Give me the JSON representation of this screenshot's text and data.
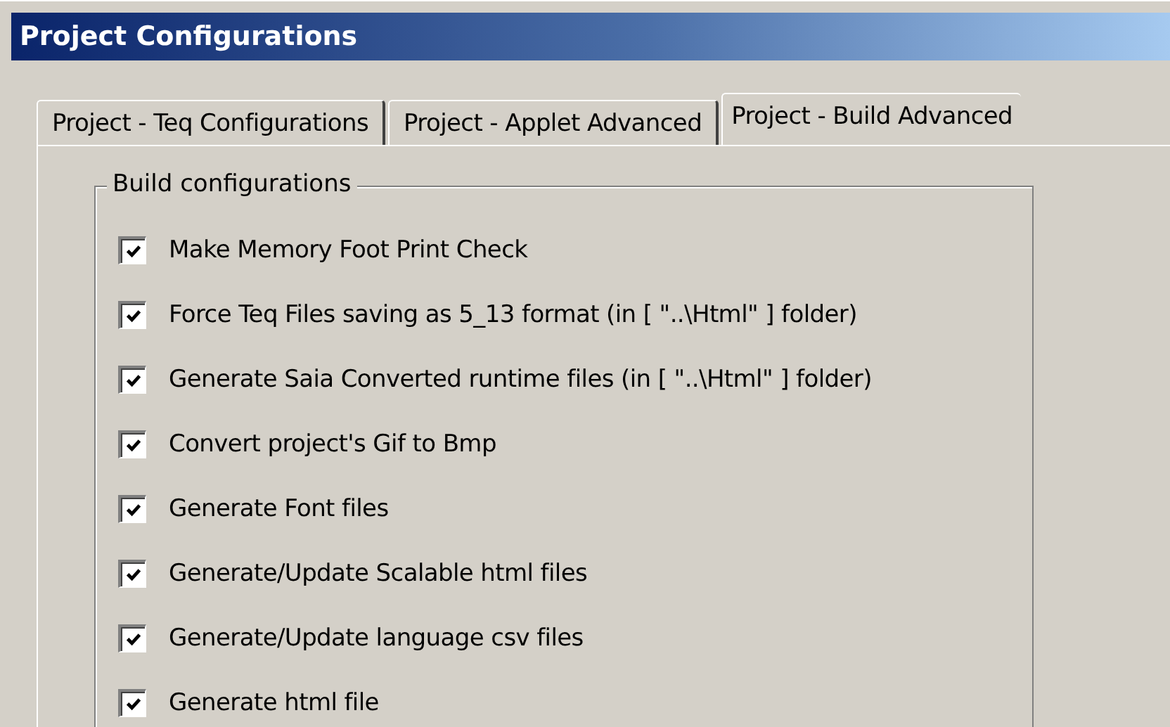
{
  "window": {
    "title": "Project Configurations"
  },
  "tabs": [
    {
      "label": "Project - Teq Configurations",
      "selected": false
    },
    {
      "label": "Project - Applet Advanced",
      "selected": false
    },
    {
      "label": "Project - Build Advanced",
      "selected": true
    }
  ],
  "group": {
    "title": "Build configurations",
    "options": [
      {
        "label": "Make Memory Foot Print Check",
        "checked": true
      },
      {
        "label": "Force Teq Files saving as 5_13 format (in [ \"..\\Html\" ] folder)",
        "checked": true
      },
      {
        "label": "Generate Saia Converted runtime files (in [ \"..\\Html\" ] folder)",
        "checked": true
      },
      {
        "label": "Convert project's Gif to Bmp",
        "checked": true
      },
      {
        "label": "Generate Font files",
        "checked": true
      },
      {
        "label": "Generate/Update Scalable html files",
        "checked": true
      },
      {
        "label": "Generate/Update language csv files",
        "checked": true
      },
      {
        "label": "Generate html file",
        "checked": true
      }
    ]
  }
}
